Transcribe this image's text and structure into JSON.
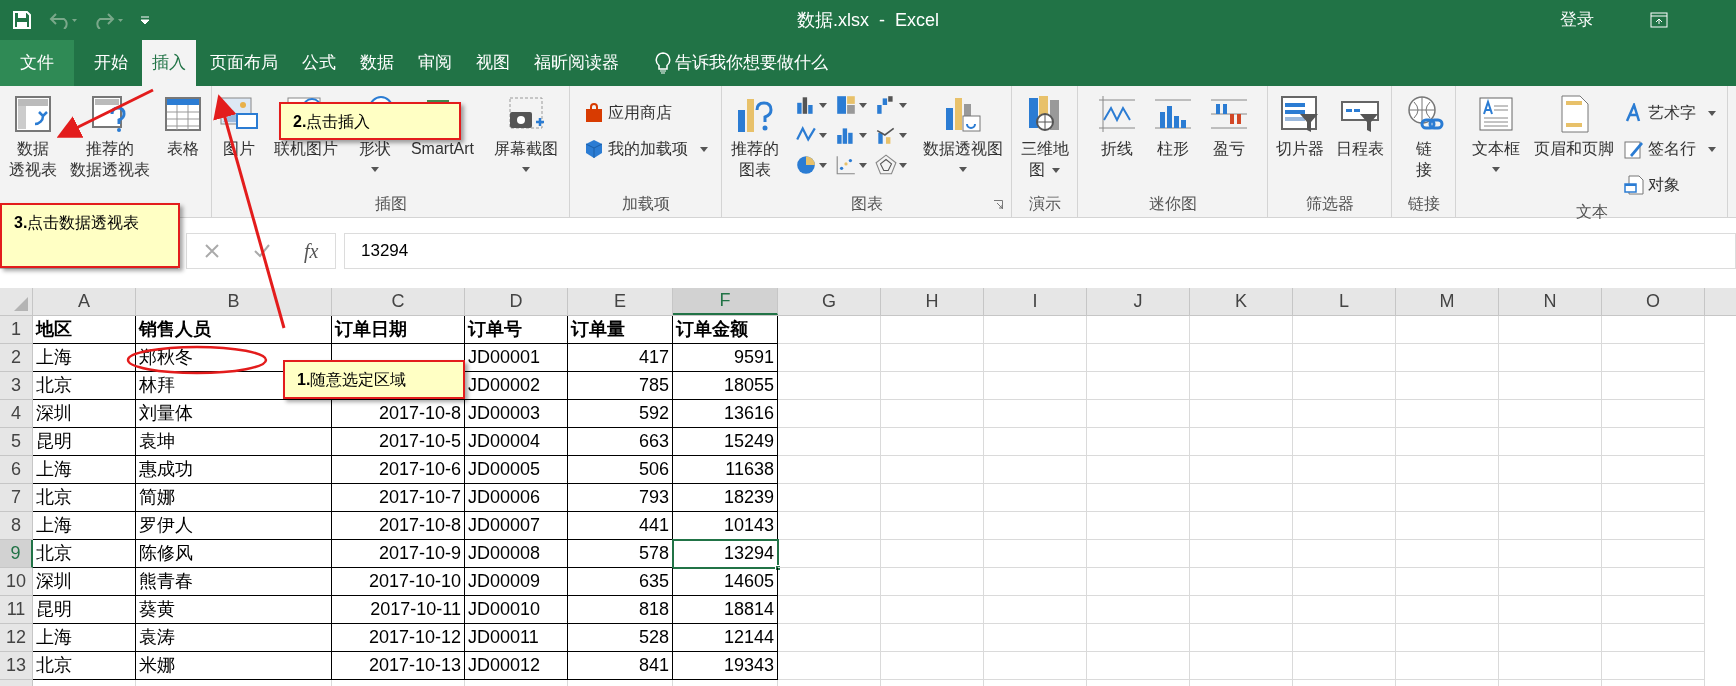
{
  "window": {
    "title": "数据.xlsx  -  Excel",
    "sign_in": "登录"
  },
  "tabs": [
    {
      "label": "文件",
      "kind": "file",
      "selected": false
    },
    {
      "label": "开始",
      "kind": "tab",
      "selected": false
    },
    {
      "label": "插入",
      "kind": "tab",
      "selected": true
    },
    {
      "label": "页面布局",
      "kind": "tab",
      "selected": false
    },
    {
      "label": "公式",
      "kind": "tab",
      "selected": false
    },
    {
      "label": "数据",
      "kind": "tab",
      "selected": false
    },
    {
      "label": "审阅",
      "kind": "tab",
      "selected": false
    },
    {
      "label": "视图",
      "kind": "tab",
      "selected": false
    },
    {
      "label": "福昕阅读器",
      "kind": "tab",
      "selected": false
    }
  ],
  "tell_me": {
    "placeholder": "告诉我你想要做什么"
  },
  "ribbon": {
    "groups": [
      {
        "items": [
          {
            "kind": "large",
            "lines": [
              "数据",
              "透视表"
            ],
            "dropdown": false
          },
          {
            "kind": "large",
            "lines": [
              "推荐的",
              "数据透视表"
            ],
            "dropdown": false
          },
          {
            "kind": "large",
            "lines": [
              "表格"
            ],
            "dropdown": false
          }
        ]
      },
      {
        "label": "插图",
        "items": [
          {
            "kind": "large",
            "lines": [
              "图片"
            ],
            "dropdown": false
          },
          {
            "kind": "large",
            "lines": [
              "联机图片"
            ],
            "dropdown": false
          },
          {
            "kind": "large",
            "lines": [
              "形状"
            ],
            "dropdown": true
          },
          {
            "kind": "large",
            "lines": [
              "SmartArt"
            ],
            "dropdown": false
          },
          {
            "kind": "large",
            "lines": [
              "屏幕截图"
            ],
            "dropdown": true
          }
        ]
      },
      {
        "label": "加载项",
        "items": [
          {
            "kind": "small",
            "lines": [
              "应用商店"
            ],
            "dropdown": false
          },
          {
            "kind": "small",
            "lines": [
              "我的加载项"
            ],
            "dropdown": true
          }
        ]
      },
      {
        "label": "图表",
        "launcher": true,
        "items": [
          {
            "kind": "large",
            "lines": [
              "推荐的",
              "图表"
            ],
            "dropdown": false
          },
          {
            "kind": "chart_grid"
          },
          {
            "kind": "large",
            "lines": [
              "数据透视图"
            ],
            "dropdown": true
          }
        ]
      },
      {
        "label": "演示",
        "items": [
          {
            "kind": "large",
            "lines": [
              "三维地",
              "图"
            ],
            "dropdown": true
          }
        ]
      },
      {
        "label": "迷你图",
        "items": [
          {
            "kind": "large",
            "lines": [
              "折线"
            ],
            "dropdown": false
          },
          {
            "kind": "large",
            "lines": [
              "柱形"
            ],
            "dropdown": false
          },
          {
            "kind": "large",
            "lines": [
              "盈亏"
            ],
            "dropdown": false
          }
        ]
      },
      {
        "label": "筛选器",
        "items": [
          {
            "kind": "large",
            "lines": [
              "切片器"
            ],
            "dropdown": false
          },
          {
            "kind": "large",
            "lines": [
              "日程表"
            ],
            "dropdown": false
          }
        ]
      },
      {
        "label": "链接",
        "items": [
          {
            "kind": "large",
            "lines": [
              "链",
              "接"
            ],
            "dropdown": false
          }
        ]
      },
      {
        "label": "文本",
        "items": [
          {
            "kind": "large",
            "lines": [
              "文本框"
            ],
            "dropdown": true
          },
          {
            "kind": "large",
            "lines": [
              "页眉和页脚"
            ],
            "dropdown": false
          },
          {
            "kind": "small",
            "lines": [
              "艺术字"
            ],
            "dropdown": true
          },
          {
            "kind": "small",
            "lines": [
              "签名行"
            ],
            "dropdown": true
          },
          {
            "kind": "small",
            "lines": [
              "对象"
            ],
            "dropdown": false
          }
        ]
      }
    ]
  },
  "formula_bar": {
    "function_label": "fx",
    "value": "13294"
  },
  "sheet": {
    "columns": [
      {
        "label": "A",
        "selected": false
      },
      {
        "label": "B",
        "selected": false
      },
      {
        "label": "C",
        "selected": false
      },
      {
        "label": "D",
        "selected": false
      },
      {
        "label": "E",
        "selected": false
      },
      {
        "label": "F",
        "selected": true
      },
      {
        "label": "G",
        "selected": false
      },
      {
        "label": "H",
        "selected": false
      },
      {
        "label": "I",
        "selected": false
      },
      {
        "label": "J",
        "selected": false
      },
      {
        "label": "K",
        "selected": false
      },
      {
        "label": "L",
        "selected": false
      },
      {
        "label": "M",
        "selected": false
      },
      {
        "label": "N",
        "selected": false
      },
      {
        "label": "O",
        "selected": false
      }
    ],
    "rows": [
      {
        "number": "1",
        "kind": "header",
        "selected": false,
        "cells": [
          {
            "text": "地区",
            "selected": false
          },
          {
            "text": "销售人员",
            "selected": false
          },
          {
            "text": "订单日期",
            "selected": false
          },
          {
            "text": "订单号",
            "selected": false
          },
          {
            "text": "订单量",
            "selected": false
          },
          {
            "text": "订单金额",
            "selected": false
          }
        ]
      },
      {
        "number": "2",
        "kind": "data",
        "selected": false,
        "cells": [
          {
            "text": "上海",
            "selected": false
          },
          {
            "text": "郑秋冬",
            "selected": false
          },
          {
            "selected": false
          },
          {
            "text": "JD00001",
            "selected": false
          },
          {
            "text": "417",
            "selected": false
          },
          {
            "text": "9591",
            "selected": false
          }
        ]
      },
      {
        "number": "3",
        "kind": "data",
        "selected": false,
        "cells": [
          {
            "text": "北京",
            "selected": false
          },
          {
            "text": "林拜",
            "selected": false
          },
          {
            "selected": false
          },
          {
            "text": "JD00002",
            "selected": false
          },
          {
            "text": "785",
            "selected": false
          },
          {
            "text": "18055",
            "selected": false
          }
        ]
      },
      {
        "number": "4",
        "kind": "data",
        "selected": false,
        "cells": [
          {
            "text": "深圳",
            "selected": false
          },
          {
            "text": "刘量体",
            "selected": false
          },
          {
            "text": "2017-10-8",
            "selected": false
          },
          {
            "text": "JD00003",
            "selected": false
          },
          {
            "text": "592",
            "selected": false
          },
          {
            "text": "13616",
            "selected": false
          }
        ]
      },
      {
        "number": "5",
        "kind": "data",
        "selected": false,
        "cells": [
          {
            "text": "昆明",
            "selected": false
          },
          {
            "text": "袁坤",
            "selected": false
          },
          {
            "text": "2017-10-5",
            "selected": false
          },
          {
            "text": "JD00004",
            "selected": false
          },
          {
            "text": "663",
            "selected": false
          },
          {
            "text": "15249",
            "selected": false
          }
        ]
      },
      {
        "number": "6",
        "kind": "data",
        "selected": false,
        "cells": [
          {
            "text": "上海",
            "selected": false
          },
          {
            "text": "惠成功",
            "selected": false
          },
          {
            "text": "2017-10-6",
            "selected": false
          },
          {
            "text": "JD00005",
            "selected": false
          },
          {
            "text": "506",
            "selected": false
          },
          {
            "text": "11638",
            "selected": false
          }
        ]
      },
      {
        "number": "7",
        "kind": "data",
        "selected": false,
        "cells": [
          {
            "text": "北京",
            "selected": false
          },
          {
            "text": "简娜",
            "selected": false
          },
          {
            "text": "2017-10-7",
            "selected": false
          },
          {
            "text": "JD00006",
            "selected": false
          },
          {
            "text": "793",
            "selected": false
          },
          {
            "text": "18239",
            "selected": false
          }
        ]
      },
      {
        "number": "8",
        "kind": "data",
        "selected": false,
        "cells": [
          {
            "text": "上海",
            "selected": false
          },
          {
            "text": "罗伊人",
            "selected": false
          },
          {
            "text": "2017-10-8",
            "selected": false
          },
          {
            "text": "JD00007",
            "selected": false
          },
          {
            "text": "441",
            "selected": false
          },
          {
            "text": "10143",
            "selected": false
          }
        ]
      },
      {
        "number": "9",
        "kind": "data",
        "selected": true,
        "cells": [
          {
            "text": "北京",
            "selected": false
          },
          {
            "text": "陈修风",
            "selected": false
          },
          {
            "text": "2017-10-9",
            "selected": false
          },
          {
            "text": "JD00008",
            "selected": false
          },
          {
            "text": "578",
            "selected": false
          },
          {
            "text": "13294",
            "selected": true
          }
        ]
      },
      {
        "number": "10",
        "kind": "data",
        "selected": false,
        "cells": [
          {
            "text": "深圳",
            "selected": false
          },
          {
            "text": "熊青春",
            "selected": false
          },
          {
            "text": "2017-10-10",
            "selected": false
          },
          {
            "text": "JD00009",
            "selected": false
          },
          {
            "text": "635",
            "selected": false
          },
          {
            "text": "14605",
            "selected": false
          }
        ]
      },
      {
        "number": "11",
        "kind": "data",
        "selected": false,
        "cells": [
          {
            "text": "昆明",
            "selected": false
          },
          {
            "text": "葵黄",
            "selected": false
          },
          {
            "text": "2017-10-11",
            "selected": false
          },
          {
            "text": "JD00010",
            "selected": false
          },
          {
            "text": "818",
            "selected": false
          },
          {
            "text": "18814",
            "selected": false
          }
        ]
      },
      {
        "number": "12",
        "kind": "data",
        "selected": false,
        "cells": [
          {
            "text": "上海",
            "selected": false
          },
          {
            "text": "袁涛",
            "selected": false
          },
          {
            "text": "2017-10-12",
            "selected": false
          },
          {
            "text": "JD00011",
            "selected": false
          },
          {
            "text": "528",
            "selected": false
          },
          {
            "text": "12144",
            "selected": false
          }
        ]
      },
      {
        "number": "13",
        "kind": "data",
        "selected": false,
        "cells": [
          {
            "text": "北京",
            "selected": false
          },
          {
            "text": "米娜",
            "selected": false
          },
          {
            "text": "2017-10-13",
            "selected": false
          },
          {
            "text": "JD00012",
            "selected": false
          },
          {
            "text": "841",
            "selected": false
          },
          {
            "text": "19343",
            "selected": false
          }
        ]
      }
    ]
  },
  "callouts": [
    {
      "text": "**2.**点击插入"
    },
    {
      "text": "**3.**点击数据透视表"
    },
    {
      "text": "**1.**随意选定区域"
    }
  ]
}
